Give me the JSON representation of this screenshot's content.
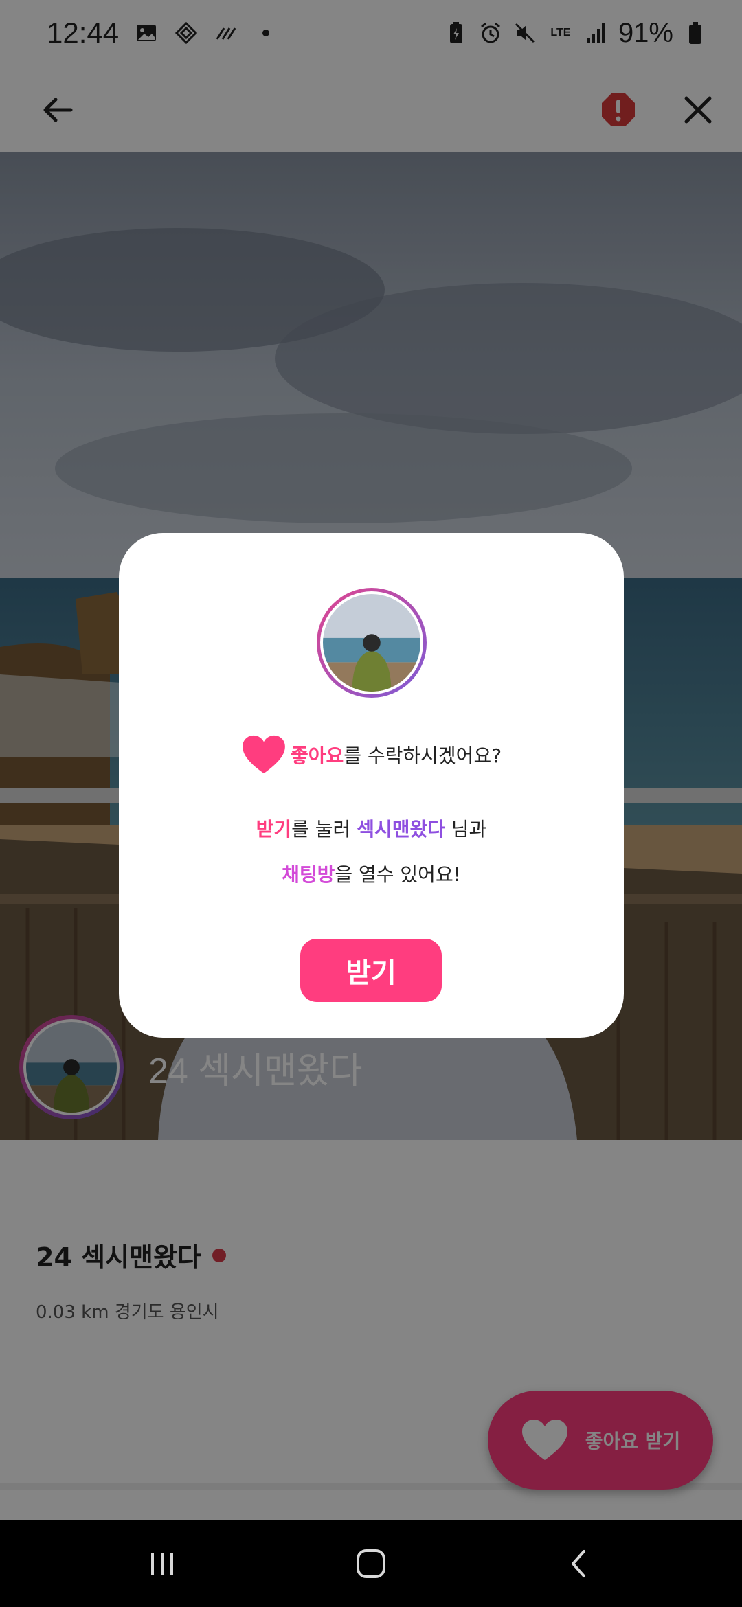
{
  "status_bar": {
    "time": "12:44",
    "battery": "91%",
    "network": "LTE"
  },
  "header": {
    "back_icon": "arrow-left-icon",
    "report_icon": "alert-octagon-icon",
    "close_icon": "close-icon",
    "report_color": "#d93a3a"
  },
  "profile": {
    "photo_name": "24 섹시맨왔다",
    "name": "24 섹시맨왔다",
    "location": "0.03 km 경기도 용인시",
    "online_color": "#d93a4a"
  },
  "fab": {
    "label": "좋아요 받기",
    "icon": "heart-icon",
    "color": "#ff3d7f"
  },
  "dialog": {
    "line1_highlight": "좋아요",
    "line1_rest": "를 수락하시겠어요?",
    "line2_highlight1": "받기",
    "line2_mid": "를 눌러 ",
    "line2_highlight2": "섹시맨왔다",
    "line2_end": " 님과",
    "line3_highlight": "채팅방",
    "line3_rest": "을 열수 있어요!",
    "button_label": "받기",
    "accent_color": "#ff3d7f",
    "purple_color": "#8e4fe0"
  },
  "nav_bar": {
    "recent_icon": "recent-apps-icon",
    "home_icon": "home-icon",
    "back_icon": "nav-back-icon"
  }
}
